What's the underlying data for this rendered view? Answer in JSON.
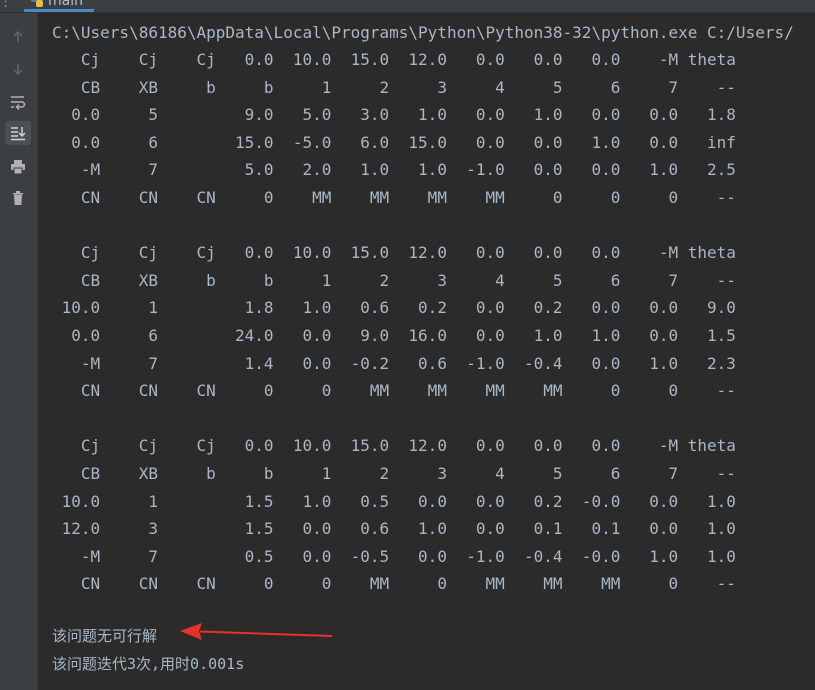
{
  "tab": {
    "label": "main"
  },
  "console": {
    "command": "C:\\Users\\86186\\AppData\\Local\\Programs\\Python\\Python38-32\\python.exe C:/Users/",
    "lines": [
      "   Cj    Cj    Cj   0.0  10.0  15.0  12.0   0.0   0.0   0.0    -M theta",
      "   CB    XB     b     b     1     2     3     4     5     6     7    --",
      "  0.0     5         9.0   5.0   3.0   1.0   0.0   1.0   0.0   0.0   1.8",
      "  0.0     6        15.0  -5.0   6.0  15.0   0.0   0.0   1.0   0.0   inf",
      "   -M     7         5.0   2.0   1.0   1.0  -1.0   0.0   0.0   1.0   2.5",
      "   CN    CN    CN     0    MM    MM    MM    MM     0     0     0    --",
      "",
      "   Cj    Cj    Cj   0.0  10.0  15.0  12.0   0.0   0.0   0.0    -M theta",
      "   CB    XB     b     b     1     2     3     4     5     6     7    --",
      " 10.0     1         1.8   1.0   0.6   0.2   0.0   0.2   0.0   0.0   9.0",
      "  0.0     6        24.0   0.0   9.0  16.0   0.0   1.0   1.0   0.0   1.5",
      "   -M     7         1.4   0.0  -0.2   0.6  -1.0  -0.4   0.0   1.0   2.3",
      "   CN    CN    CN     0     0    MM    MM    MM    MM     0     0    --",
      "",
      "   Cj    Cj    Cj   0.0  10.0  15.0  12.0   0.0   0.0   0.0    -M theta",
      "   CB    XB     b     b     1     2     3     4     5     6     7    --",
      " 10.0     1         1.5   1.0   0.5   0.0   0.0   0.2  -0.0   0.0   1.0",
      " 12.0     3         1.5   0.0   0.6   1.0   0.0   0.1   0.1   0.0   1.0",
      "   -M     7         0.5   0.0  -0.5   0.0  -1.0  -0.4  -0.0   1.0   1.0",
      "   CN    CN    CN     0     0    MM     0    MM    MM    MM     0    --"
    ],
    "message_infeasible": "该问题无可行解",
    "message_iterations": "该问题迭代3次,用时0.001s"
  },
  "colors": {
    "arrow": "#e8312a",
    "text": "#a9b7c6",
    "background": "#2b2b2b"
  },
  "icons": [
    "python-icon",
    "arrow-up-icon",
    "arrow-down-icon",
    "soft-wrap-icon",
    "scroll-to-end-icon",
    "print-icon",
    "trash-icon"
  ]
}
